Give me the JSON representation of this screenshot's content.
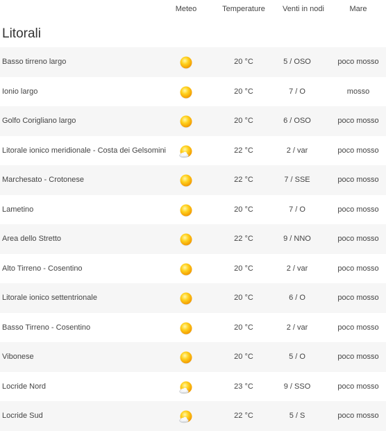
{
  "header": {
    "meteo": "Meteo",
    "temperature": "Temperature",
    "wind": "Venti in nodi",
    "sea": "Mare"
  },
  "section_title": "Litorali",
  "rows": [
    {
      "location": "Basso tirreno largo",
      "icon": "sun-icon",
      "temp": "20 °C",
      "wind": "5 / OSO",
      "sea": "poco mosso"
    },
    {
      "location": "Ionio largo",
      "icon": "sun-icon",
      "temp": "20 °C",
      "wind": "7 / O",
      "sea": "mosso"
    },
    {
      "location": "Golfo Corigliano largo",
      "icon": "sun-icon",
      "temp": "20 °C",
      "wind": "6 / OSO",
      "sea": "poco mosso"
    },
    {
      "location": "Litorale ionico meridionale - Costa dei Gelsomini",
      "icon": "sun-cloud-icon",
      "temp": "22 °C",
      "wind": "2 / var",
      "sea": "poco mosso"
    },
    {
      "location": "Marchesato - Crotonese",
      "icon": "sun-icon",
      "temp": "22 °C",
      "wind": "7 / SSE",
      "sea": "poco mosso"
    },
    {
      "location": "Lametino",
      "icon": "sun-icon",
      "temp": "20 °C",
      "wind": "7 / O",
      "sea": "poco mosso"
    },
    {
      "location": "Area dello Stretto",
      "icon": "sun-icon",
      "temp": "22 °C",
      "wind": "9 / NNO",
      "sea": "poco mosso"
    },
    {
      "location": "Alto Tirreno - Cosentino",
      "icon": "sun-icon",
      "temp": "20 °C",
      "wind": "2 / var",
      "sea": "poco mosso"
    },
    {
      "location": "Litorale ionico settentrionale",
      "icon": "sun-icon",
      "temp": "20 °C",
      "wind": "6 / O",
      "sea": "poco mosso"
    },
    {
      "location": "Basso Tirreno - Cosentino",
      "icon": "sun-icon",
      "temp": "20 °C",
      "wind": "2 / var",
      "sea": "poco mosso"
    },
    {
      "location": "Vibonese",
      "icon": "sun-icon",
      "temp": "20 °C",
      "wind": "5 / O",
      "sea": "poco mosso"
    },
    {
      "location": "Locride Nord",
      "icon": "sun-cloud-icon",
      "temp": "23 °C",
      "wind": "9 / SSO",
      "sea": "poco mosso"
    },
    {
      "location": "Locride Sud",
      "icon": "sun-cloud-icon",
      "temp": "22 °C",
      "wind": "5 / S",
      "sea": "poco mosso"
    }
  ]
}
